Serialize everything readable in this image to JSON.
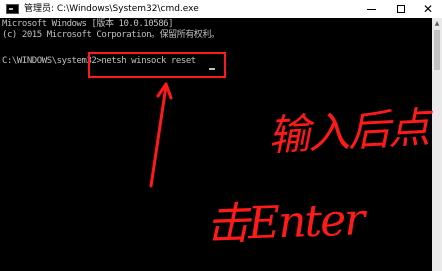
{
  "window": {
    "title": "管理员: C:\\Windows\\System32\\cmd.exe",
    "icon": "cmd-icon"
  },
  "console": {
    "lines": [
      "Microsoft Windows [版本 10.0.10586]",
      "(c) 2015 Microsoft Corporation。保留所有权利。",
      "C:\\WINDOWS\\system32>netsh winsock reset"
    ]
  },
  "annotation": {
    "line1": "输入后点",
    "line2": "击Enter",
    "color": "#ff1a1a"
  },
  "colors": {
    "console_bg": "#000000",
    "console_text": "#c0c0c0",
    "titlebar_bg": "#ffffff"
  }
}
